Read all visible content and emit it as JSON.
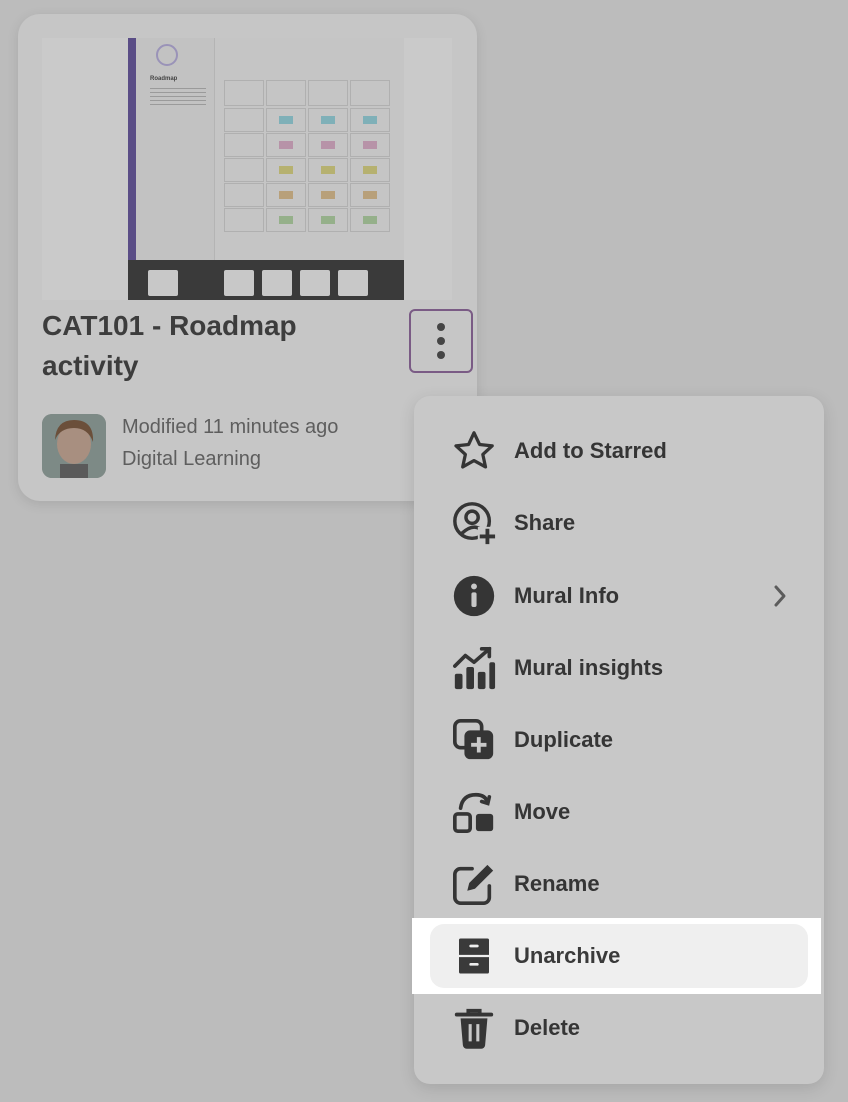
{
  "card": {
    "title": "CAT101 - Roadmap activity",
    "modified": "Modified 11 minutes ago",
    "workspace": "Digital Learning",
    "thumbnail_board_title": "Roadmap"
  },
  "menu": {
    "items": [
      {
        "label": "Add to Starred",
        "icon": "star-icon"
      },
      {
        "label": "Share",
        "icon": "share-user-icon"
      },
      {
        "label": "Mural Info",
        "icon": "info-icon",
        "has_submenu": true
      },
      {
        "label": "Mural insights",
        "icon": "insights-chart-icon"
      },
      {
        "label": "Duplicate",
        "icon": "duplicate-icon"
      },
      {
        "label": "Move",
        "icon": "move-icon"
      },
      {
        "label": "Rename",
        "icon": "rename-pencil-icon"
      },
      {
        "label": "Unarchive",
        "icon": "archive-cabinet-icon",
        "highlighted": true
      },
      {
        "label": "Delete",
        "icon": "trash-icon"
      }
    ]
  },
  "colors": {
    "overlay_bg": "#bcbcbc",
    "card_bg": "#c6c6c6",
    "menu_bg": "#c8c8c8",
    "focus_outline": "#7a5b85",
    "highlight_bg": "#ffffff",
    "text_dark": "#353535"
  }
}
